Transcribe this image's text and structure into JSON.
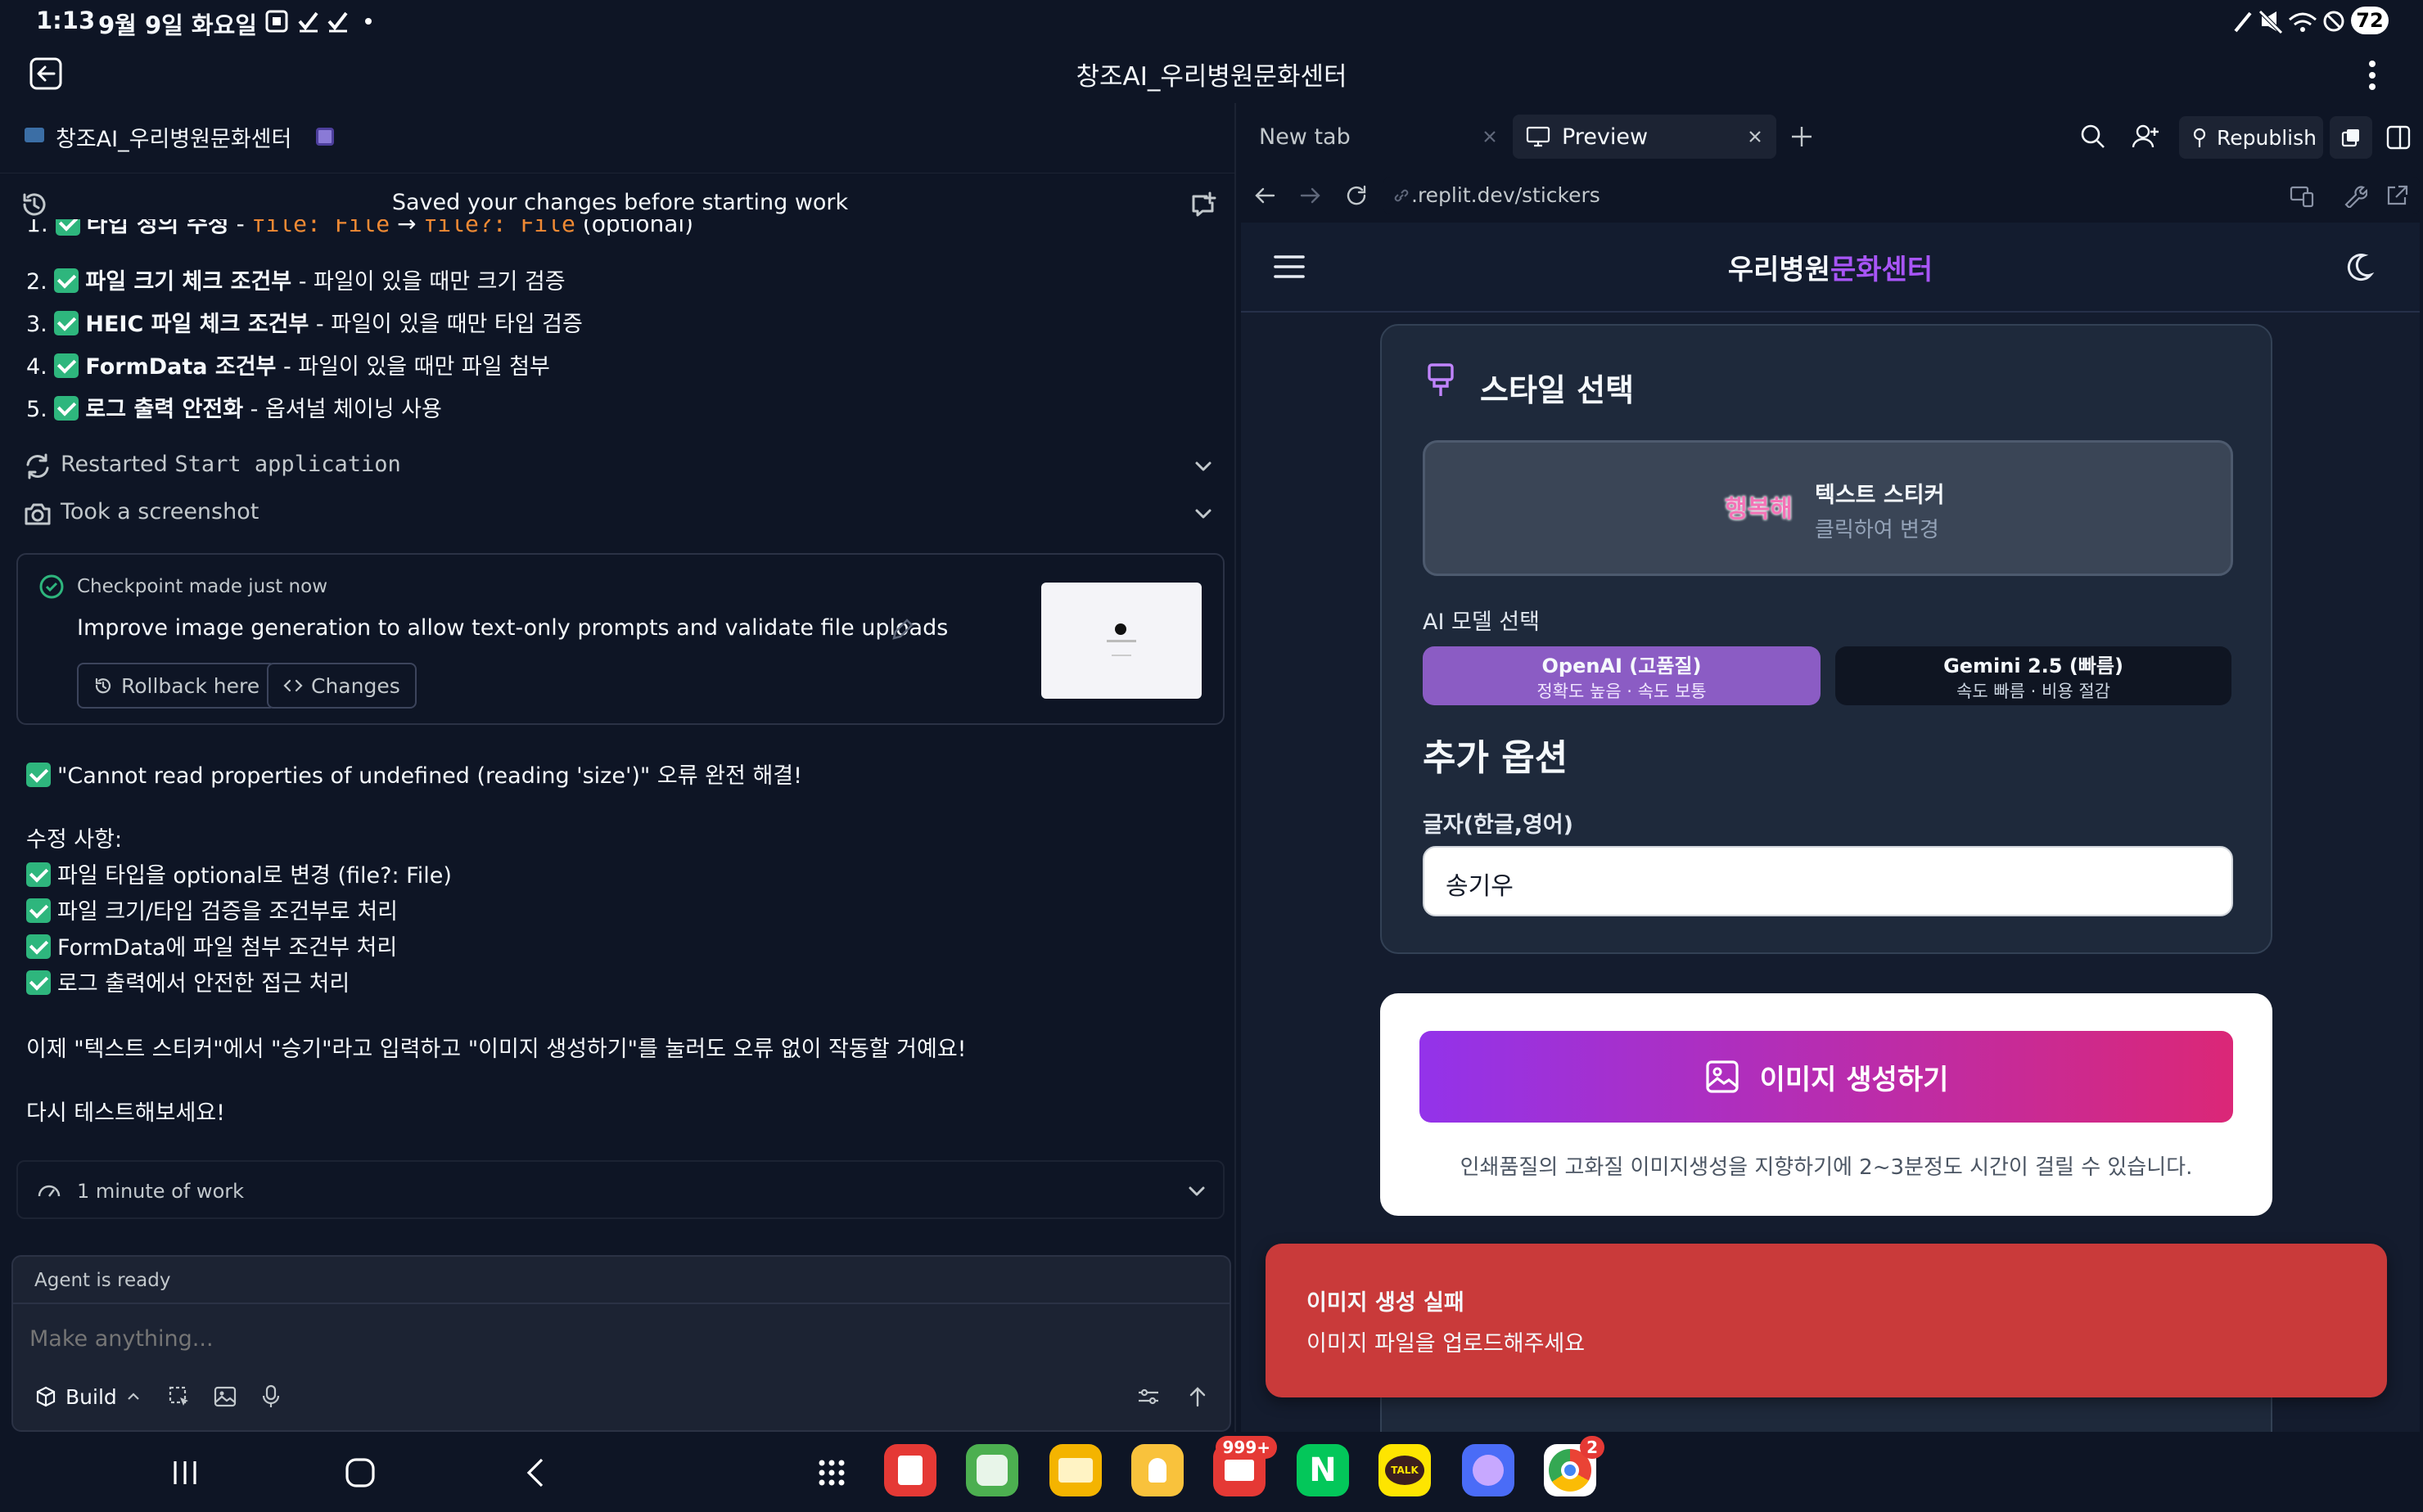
{
  "colors": {
    "bg": "#0e1525",
    "accent": "#2eb67d",
    "purple": "#7b4bd4",
    "error": "#c93a3a",
    "logo": "#a855f7"
  },
  "status": {
    "time": "1:13",
    "date": "9월 9일 화요일",
    "battery": "72"
  },
  "app": {
    "title": "창조AI_우리병원문화센터"
  },
  "left": {
    "project_name": "창조AI_우리병원문화센터",
    "header_title": "Saved your changes before starting work",
    "list_items": [
      {
        "num": "1.",
        "bold": "타입 정의 수정",
        "rest": " - ",
        "code1": "file: File",
        "arrow": " → ",
        "code2": "file?: File",
        "tail": " (optional)"
      },
      {
        "num": "2.",
        "bold": "파일 크기 체크 조건부",
        "rest": " - 파일이 있을 때만 크기 검증"
      },
      {
        "num": "3.",
        "bold": "HEIC 파일 체크 조건부",
        "rest": " - 파일이 있을 때만 타입 검증"
      },
      {
        "num": "4.",
        "bold": "FormData 조건부",
        "rest": " - 파일이 있을 때만 파일 첨부"
      },
      {
        "num": "5.",
        "bold": "로그 출력 안전화",
        "rest": " - 옵셔널 체이닝 사용"
      }
    ],
    "actions": [
      {
        "label": "Restarted",
        "mono": "Start application"
      },
      {
        "label": "Took a screenshot"
      }
    ],
    "checkpoint": {
      "title": "Checkpoint made just now",
      "message": "Improve image generation to allow text-only prompts and validate file uploads",
      "rollback": "Rollback here",
      "changes": "Changes"
    },
    "message": {
      "headline": "\"Cannot read properties of undefined (reading 'size')\" 오류 완전 해결!",
      "section": "수정 사항:",
      "fixes": [
        "파일 타입을 optional로 변경 (file?: File)",
        "파일 크기/타입 검증을 조건부로 처리",
        "FormData에 파일 첨부 조건부 처리",
        "로그 출력에서 안전한 접근 처리"
      ],
      "para1": "이제 \"텍스트 스티커\"에서 \"승기\"라고 입력하고 \"이미지 생성하기\"를 눌러도 오류 없이 작동할 거예요!",
      "para2": "다시 테스트해보세요!"
    },
    "work": "1 minute of work",
    "composer": {
      "status": "Agent is ready",
      "placeholder": "Make anything...",
      "mode": "Build"
    }
  },
  "right": {
    "tabs": [
      {
        "label": "New tab"
      },
      {
        "label": "Preview"
      }
    ],
    "republish": "Republish",
    "url": ".replit.dev/stickers",
    "site": {
      "logo_a": "우리병원",
      "logo_b": "문화센터",
      "style_heading": "스타일 선택",
      "style_card": {
        "thumb": "행복해",
        "title": "텍스트 스티커",
        "sub": "클릭하여 변경"
      },
      "model_label": "AI 모델 선택",
      "models": [
        {
          "name": "OpenAI (고품질)",
          "desc": "정확도 높음 · 속도 보통"
        },
        {
          "name": "Gemini 2.5 (빠름)",
          "desc": "속도 빠름 · 비용 절감"
        }
      ],
      "extra_heading": "추가 옵션",
      "text_label": "글자(한글,영어)",
      "text_value": "송기우",
      "generate": "이미지 생성하기",
      "notice": "인쇄품질의 고화질 이미지생성을 지향하기에 2~3분정도 시간이 걸릴 수 있습니다.",
      "toast": {
        "title": "이미지 생성 실패",
        "body": "이미지 파일을 업로드해주세요"
      }
    }
  },
  "dock": {
    "mail_badge": "999+",
    "chrome_badge": "2",
    "talk": "TALK"
  }
}
